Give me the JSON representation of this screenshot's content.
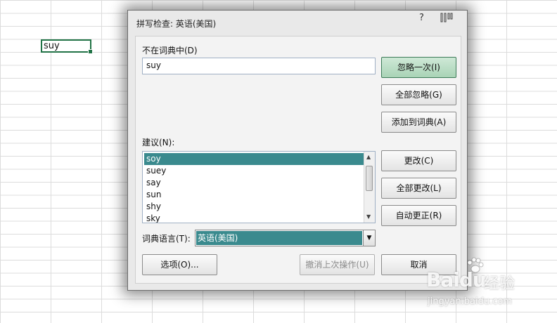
{
  "sheet": {
    "active_cell_value": "suy"
  },
  "dialog": {
    "title": "拼写检查: 英语(美国)",
    "help_icon": "?",
    "close_icon": "x",
    "not_in_dictionary_label": "不在词典中(D)",
    "not_in_dictionary_value": "suy",
    "suggestions_label": "建议(N):",
    "suggestions": [
      "soy",
      "suey",
      "say",
      "sun",
      "shy",
      "sky"
    ],
    "selected_suggestion": "soy",
    "dictionary_language_label": "词典语言(T):",
    "dictionary_language_value": "英语(美国)",
    "buttons": {
      "ignore_once": "忽略一次(I)",
      "ignore_all": "全部忽略(G)",
      "add_to_dictionary": "添加到词典(A)",
      "change": "更改(C)",
      "change_all": "全部更改(L)",
      "autocorrect": "自动更正(R)",
      "options": "选项(O)...",
      "undo_last": "撤消上次操作(U)",
      "cancel": "取消"
    },
    "colors": {
      "selection": "#3a8a8e",
      "primary_button": "#a9d3b6",
      "cell_border": "#217346"
    }
  },
  "watermark": {
    "logo": "Baidu",
    "text": "经验",
    "url": "jingyan.baidu.com"
  }
}
